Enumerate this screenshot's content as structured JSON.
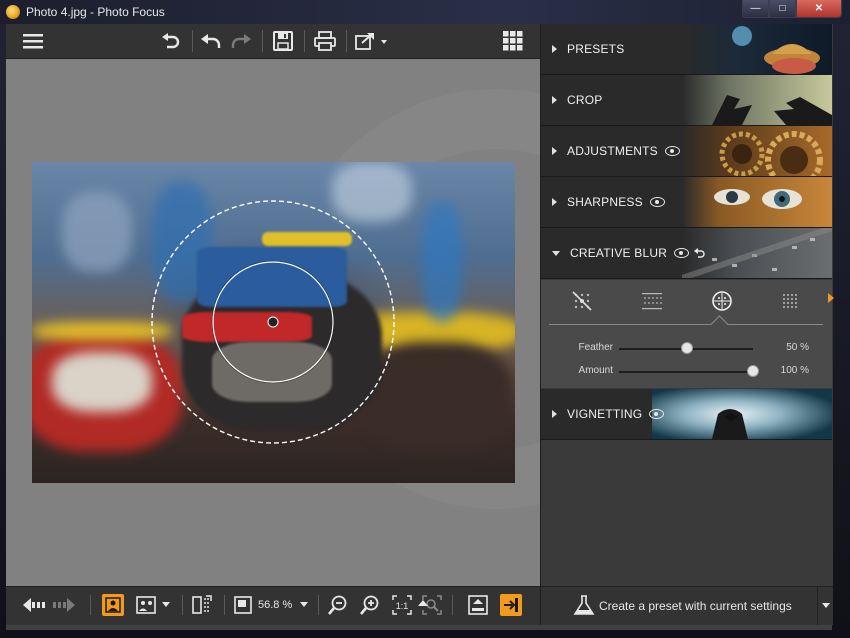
{
  "window": {
    "title": "Photo 4.jpg - Photo Focus",
    "min_glyph": "—",
    "max_glyph": "□",
    "close_glyph": "✕"
  },
  "panel": {
    "sections": [
      {
        "label": "PRESETS",
        "eye": false,
        "expanded": false
      },
      {
        "label": "CROP",
        "eye": false,
        "expanded": false
      },
      {
        "label": "ADJUSTMENTS",
        "eye": true,
        "expanded": false
      },
      {
        "label": "SHARPNESS",
        "eye": true,
        "expanded": false
      },
      {
        "label": "CREATIVE BLUR",
        "eye": true,
        "expanded": true
      },
      {
        "label": "VIGNETTING",
        "eye": true,
        "expanded": false
      }
    ],
    "creative_blur": {
      "sliders": [
        {
          "name": "Feather",
          "value": "50 %",
          "level": 0.5
        },
        {
          "name": "Amount",
          "value": "100 %",
          "level": 1.0
        }
      ]
    }
  },
  "bottom": {
    "zoom": "56.8 %",
    "preset_label": "Create a preset with current settings"
  },
  "colors": {
    "accent": "#f29a1e",
    "panel_bg": "#3a3a3a",
    "canvas_bg": "#818181"
  }
}
